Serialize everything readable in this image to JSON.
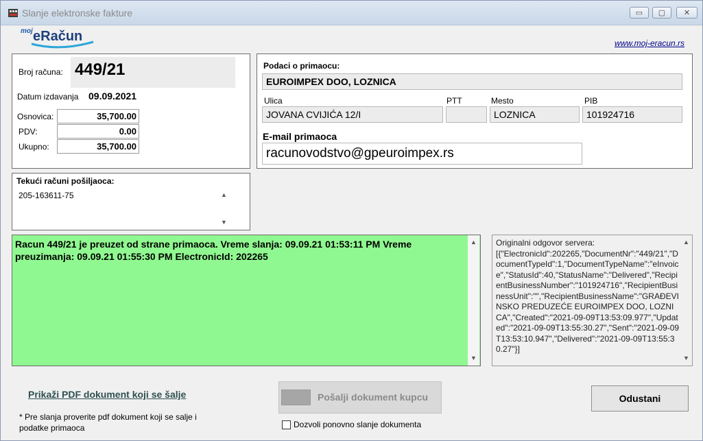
{
  "window": {
    "title": "Slanje elektronske fakture",
    "controls": {
      "minimize": "▭",
      "maximize": "▢",
      "close": "✕"
    }
  },
  "logo": {
    "prefix": "moj",
    "name": "eRačun"
  },
  "site_link": "www.moj-eracun.rs",
  "invoice": {
    "number_label": "Broj računa:",
    "number": "449/21",
    "date_label": "Datum izdavanja",
    "date": "09.09.2021",
    "base_label": "Osnovica:",
    "base": "35,700.00",
    "vat_label": "PDV:",
    "vat": "0.00",
    "total_label": "Ukupno:",
    "total": "35,700.00"
  },
  "recipient": {
    "section_label": "Podaci o primaocu:",
    "name": "EUROIMPEX DOO, LOZNICA",
    "street_label": "Ulica",
    "street": "JOVANA CVIJIĆA 12/I",
    "postal_label": "PTT",
    "postal": "",
    "city_label": "Mesto",
    "city": "LOZNICA",
    "pib_label": "PIB",
    "pib": "101924716",
    "email_label": "E-mail primaoca",
    "email": "racunovodstvo@gpeuroimpex.rs"
  },
  "accounts": {
    "label": "Tekući računi pošiljaoca:",
    "value": "205-163611-75"
  },
  "status": {
    "message": "Racun 449/21 je preuzet od strane primaoca. Vreme slanja: 09.09.21 01:53:11 PM Vreme preuzimanja: 09.09.21 01:55:30 PM ElectronicId: 202265"
  },
  "server_response": {
    "label": "Originalni odgovor servera:",
    "body": "[{\"ElectronicId\":202265,\"DocumentNr\":\"449/21\",\"DocumentTypeId\":1,\"DocumentTypeName\":\"eInvoice\",\"StatusId\":40,\"StatusName\":\"Delivered\",\"RecipientBusinessNumber\":\"101924716\",\"RecipientBusinessUnit\":\"\",\"RecipientBusinessName\":\"GRAĐEVINSKO PREDUZEĆE EUROIMPEX DOO, LOZNICA\",\"Created\":\"2021-09-09T13:53:09.977\",\"Updated\":\"2021-09-09T13:55:30.27\",\"Sent\":\"2021-09-09T13:53:10.947\",\"Delivered\":\"2021-09-09T13:55:30.27\"}]"
  },
  "actions": {
    "pdf_link": "Prikaži PDF dokument koji se šalje",
    "note": "* Pre slanja proverite pdf dokument koji se salje i podatke primaoca",
    "send_button": "Pošalji dokument kupcu",
    "cancel_button": "Odustani",
    "resend_checkbox": "Dozvoli ponovno slanje dokumenta",
    "resend_checked": false
  },
  "colors": {
    "status_bg": "#90f890",
    "link": "#00008b"
  }
}
